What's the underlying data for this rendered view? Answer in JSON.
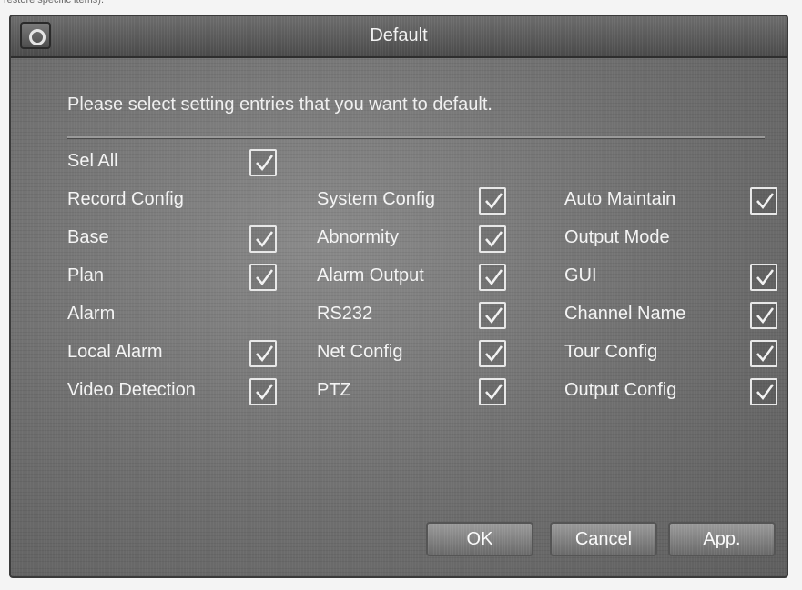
{
  "page_caption": "restore specific items).",
  "dialog": {
    "title": "Default",
    "prompt": "Please select setting entries that you want to default.",
    "sel_all": {
      "label": "Sel All",
      "checked": true
    },
    "columns": [
      [
        {
          "label": "Record Config",
          "checkbox": false
        },
        {
          "label": "Base",
          "checkbox": true,
          "checked": true
        },
        {
          "label": "Plan",
          "checkbox": true,
          "checked": true
        },
        {
          "label": "Alarm",
          "checkbox": false
        },
        {
          "label": "Local Alarm",
          "checkbox": true,
          "checked": true
        },
        {
          "label": "Video Detection",
          "checkbox": true,
          "checked": true
        }
      ],
      [
        {
          "label": "System Config",
          "checkbox": true,
          "checked": true
        },
        {
          "label": "Abnormity",
          "checkbox": true,
          "checked": true
        },
        {
          "label": "Alarm Output",
          "checkbox": true,
          "checked": true
        },
        {
          "label": "RS232",
          "checkbox": true,
          "checked": true
        },
        {
          "label": "Net Config",
          "checkbox": true,
          "checked": true
        },
        {
          "label": "PTZ",
          "checkbox": true,
          "checked": true
        }
      ],
      [
        {
          "label": "Auto Maintain",
          "checkbox": true,
          "checked": true
        },
        {
          "label": "Output Mode",
          "checkbox": false
        },
        {
          "label": "GUI",
          "checkbox": true,
          "checked": true
        },
        {
          "label": "Channel Name",
          "checkbox": true,
          "checked": true
        },
        {
          "label": "Tour Config",
          "checkbox": true,
          "checked": true
        },
        {
          "label": "Output Config",
          "checkbox": true,
          "checked": true
        }
      ]
    ],
    "buttons": {
      "ok": "OK",
      "cancel": "Cancel",
      "apply": "App."
    }
  }
}
